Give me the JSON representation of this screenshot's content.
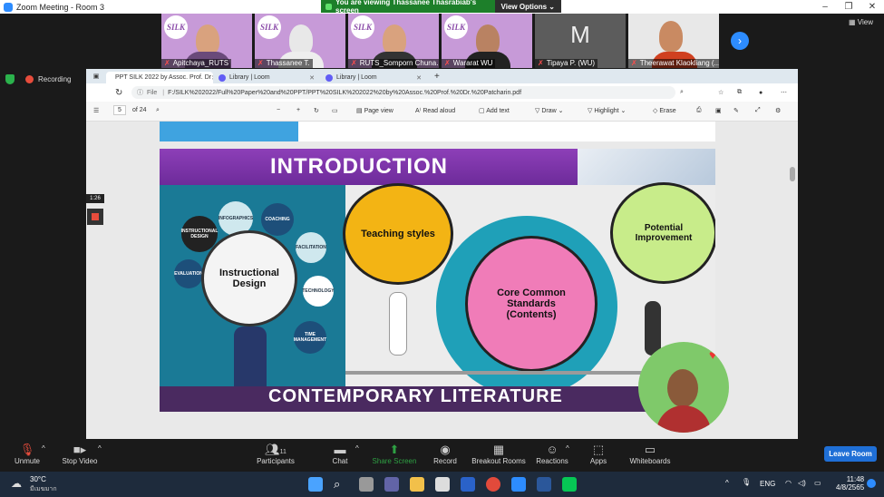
{
  "window": {
    "title": "Zoom Meeting - Room 3"
  },
  "share_banner": {
    "message": "You are viewing Thassanee Thasrabiab's screen",
    "view_options": "View Options"
  },
  "participants": [
    {
      "name": "Apitchaya_RUTS"
    },
    {
      "name": "Thassanee T."
    },
    {
      "name": "RUTS_Somporn Chuna..."
    },
    {
      "name": "Wararat WU"
    },
    {
      "name": "Tipaya P. (WU)",
      "initial": "M"
    },
    {
      "name": "Theerawat Klaokliang (..."
    }
  ],
  "top_right": {
    "view": "View"
  },
  "recording": {
    "label": "Recording"
  },
  "browser": {
    "tabs": [
      {
        "label": "PPT SILK 2022 by Assoc. Prof. Dr"
      },
      {
        "label": "Library | Loom"
      },
      {
        "label": "Library | Loom"
      }
    ],
    "url": "F:/SILK%202022/Full%20Paper%20and%20PPT/PPT%20SILK%202022%20by%20Assoc.%20Prof.%20Dr.%20Patcharin.pdf",
    "file_label": "File",
    "pdf": {
      "page_current": "5",
      "page_total": "of 24",
      "page_view": "Page view",
      "read_aloud": "Read aloud",
      "add_text": "Add text",
      "draw": "Draw",
      "highlight": "Highlight",
      "erase": "Erase"
    }
  },
  "slide": {
    "heading": "INTRODUCTION",
    "instructional_design": "Instructional Design",
    "teaching_styles": "Teaching styles",
    "core_standards": "Core Common Standards (Contents)",
    "potential": "Potential Improvement",
    "small_bubbles": [
      "INFOGRAPHICS",
      "COACHING",
      "FACILITATION",
      "TECHNOLOGY",
      "TIME MANAGEMENT",
      "EVALUATION",
      "INSTRUCTIONAL DESIGN"
    ],
    "bottom_heading": "CONTEMPORARY LITERATURE"
  },
  "loom": {
    "timer": "1:26"
  },
  "toolbar": {
    "unmute": "Unmute",
    "stop_video": "Stop Video",
    "participants": "Participants",
    "participants_count": "11",
    "chat": "Chat",
    "share_screen": "Share Screen",
    "record": "Record",
    "breakout": "Breakout Rooms",
    "reactions": "Reactions",
    "apps": "Apps",
    "whiteboards": "Whiteboards",
    "leave": "Leave Room"
  },
  "taskbar": {
    "weather_temp": "30°C",
    "weather_desc": "มีเมฆมาก",
    "lang": "ENG",
    "time": "11:48",
    "date": "4/8/2565"
  }
}
